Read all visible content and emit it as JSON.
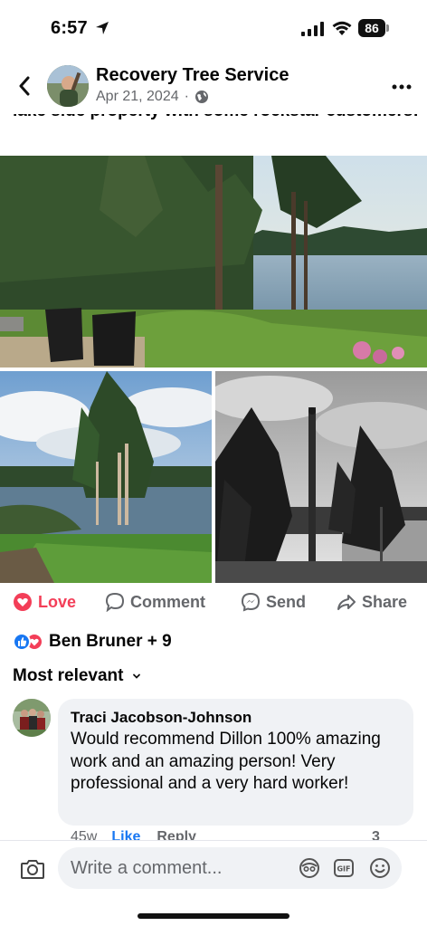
{
  "status_bar": {
    "time": "6:57",
    "battery": "86"
  },
  "post": {
    "back_icon": "chevron-left-icon",
    "page_name": "Recovery Tree Service",
    "date": "Apr 21, 2024",
    "separator": "·",
    "audience_icon": "globe-icon",
    "caption": "lake side property with some rockstar customers!"
  },
  "photos": [
    {
      "alt": "lakeside trees"
    },
    {
      "alt": "tall trees by lake"
    },
    {
      "alt": "climber on trimmed tree"
    }
  ],
  "actions": {
    "love": "Love",
    "comment": "Comment",
    "send": "Send",
    "share": "Share"
  },
  "reactions": {
    "summary": "Ben Bruner + 9"
  },
  "comments_sort": {
    "label": "Most relevant"
  },
  "comment": {
    "author": "Traci Jacobson-Johnson",
    "text": "Would recommend Dillon 100% amazing work and an amazing person!  Very professional and a very hard worker!",
    "time": "45w",
    "like": "Like",
    "reply": "Reply",
    "reaction_count": "3"
  },
  "composer": {
    "placeholder": "Write a comment..."
  },
  "colors": {
    "love": "#f33e58",
    "like": "#1877f2",
    "secondary_text": "#65676b",
    "bubble": "#f0f2f5"
  }
}
